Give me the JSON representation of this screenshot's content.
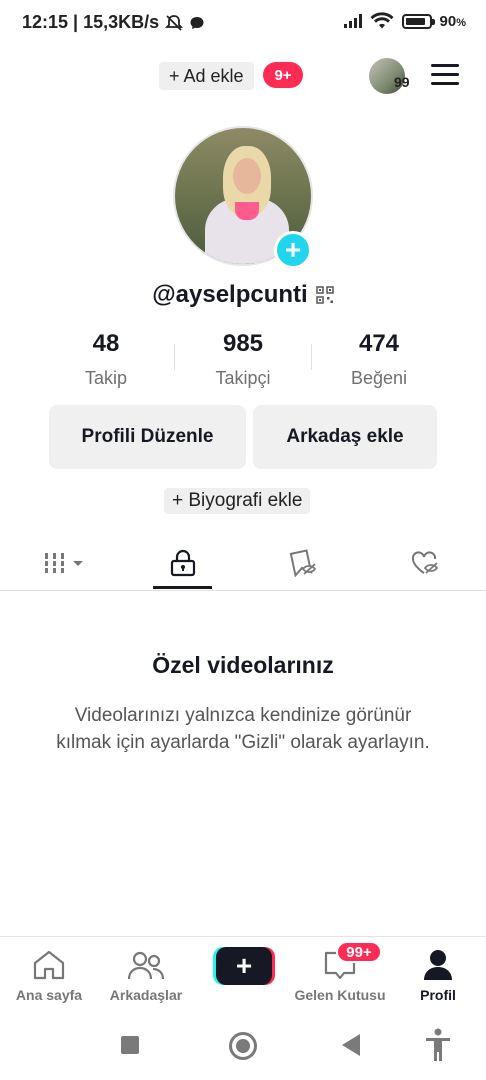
{
  "status_bar": {
    "time_speed": "12:15 | 15,3KB/s",
    "battery": "90",
    "battery_unit": "%",
    "battery_level": 0.9
  },
  "top_bar": {
    "ad_label": "+ Ad ekle",
    "ad_badge": "9+",
    "account_count": "99"
  },
  "profile": {
    "username": "@ayselpcunti",
    "stats": [
      {
        "value": "48",
        "label": "Takip"
      },
      {
        "value": "985",
        "label": "Takipçi"
      },
      {
        "value": "474",
        "label": "Beğeni"
      }
    ],
    "edit_button": "Profili Düzenle",
    "add_friend_button": "Arkadaş ekle",
    "bio_button": "+ Biyografi ekle"
  },
  "tabs": [
    {
      "icon": "grid-icon",
      "active": false
    },
    {
      "icon": "lock-icon",
      "active": true
    },
    {
      "icon": "bookmark-hidden-icon",
      "active": false
    },
    {
      "icon": "heart-hidden-icon",
      "active": false
    }
  ],
  "empty_state": {
    "title": "Özel videolarınız",
    "text": "Videolarınızı yalnızca kendinize görünür kılmak için ayarlarda \"Gizli\" olarak ayarlayın."
  },
  "bottom_nav": {
    "home": "Ana sayfa",
    "friends": "Arkadaşlar",
    "inbox": "Gelen Kutusu",
    "inbox_badge": "99+",
    "profile": "Profil"
  },
  "colors": {
    "accent_red": "#fe2c55",
    "accent_cyan": "#25f4ee",
    "plus_cyan": "#20d5ec",
    "text": "#161823"
  }
}
